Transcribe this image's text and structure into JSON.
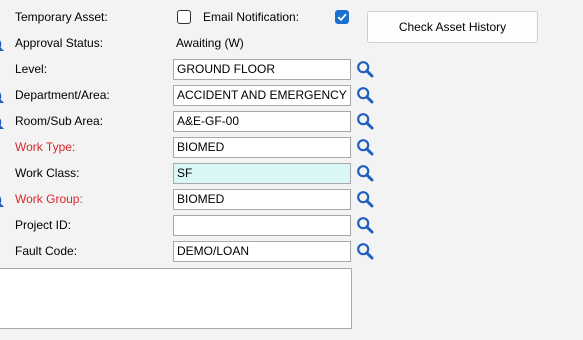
{
  "form": {
    "temporary_asset": {
      "label": "Temporary Asset:",
      "checked": false
    },
    "email_notification": {
      "label": "Email Notification:",
      "checked": true
    },
    "check_asset_history_label": "Check Asset History",
    "approval_status": {
      "label": "Approval Status:",
      "value": "Awaiting (W)"
    },
    "fields": {
      "level": {
        "label": "Level:",
        "value": "GROUND FLOOR"
      },
      "department": {
        "label": "Department/Area:",
        "value": "ACCIDENT AND EMERGENCY"
      },
      "room": {
        "label": "Room/Sub Area:",
        "value": "A&E-GF-00"
      },
      "work_type": {
        "label": "Work Type:",
        "value": "BIOMED",
        "required": true
      },
      "work_class": {
        "label": "Work Class:",
        "value": "SF"
      },
      "work_group": {
        "label": "Work Group:",
        "value": "BIOMED",
        "required": true
      },
      "project_id": {
        "label": "Project ID:",
        "value": ""
      },
      "fault_code": {
        "label": "Fault Code:",
        "value": "DEMO/LOAN"
      }
    },
    "notes": ""
  },
  "colors": {
    "required_label": "#d9262e",
    "lookup_icon": "#1f5fbf",
    "checkbox_checked": "#1b6fd1",
    "highlight_field": "#d9f7f7"
  },
  "icons": {
    "lookup": "magnifier-icon",
    "check": "checkmark-icon"
  }
}
